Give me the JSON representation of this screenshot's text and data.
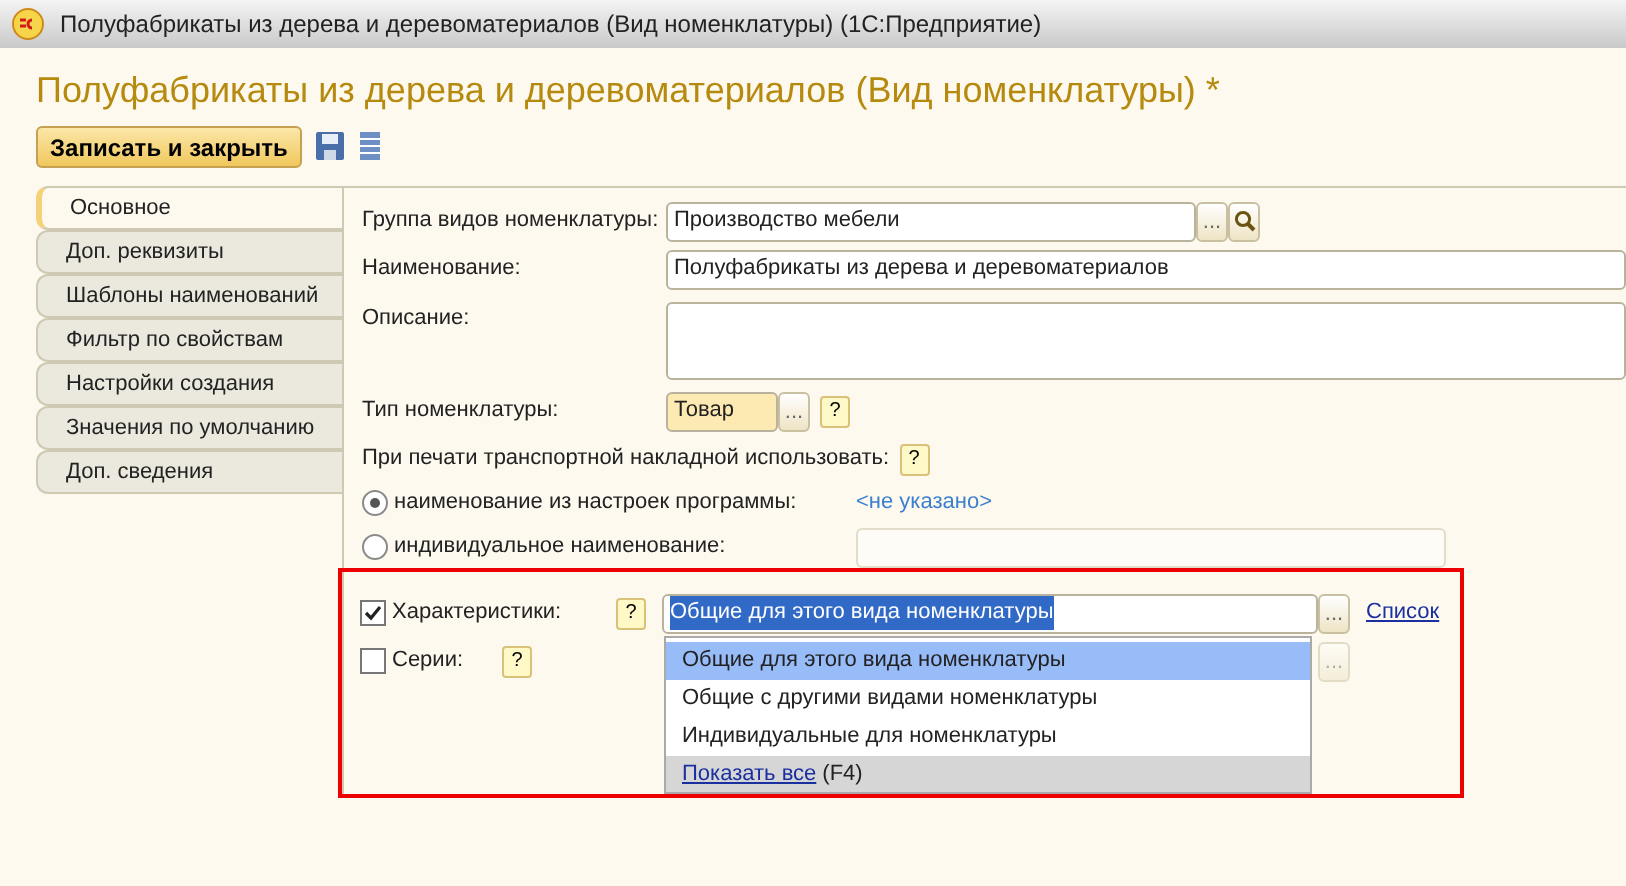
{
  "window": {
    "title": "Полуфабрикаты из дерева и деревоматериалов (Вид номенклатуры)  (1С:Предприятие)"
  },
  "form": {
    "title": "Полуфабрикаты из дерева и деревоматериалов (Вид номенклатуры) *"
  },
  "toolbar": {
    "primary_button": "Записать и закрыть"
  },
  "tabs": [
    {
      "label": "Основное",
      "selected": true
    },
    {
      "label": "Доп. реквизиты",
      "selected": false
    },
    {
      "label": "Шаблоны наименований",
      "selected": false
    },
    {
      "label": "Фильтр по свойствам",
      "selected": false
    },
    {
      "label": "Настройки создания",
      "selected": false
    },
    {
      "label": "Значения по умолчанию",
      "selected": false
    },
    {
      "label": "Доп. сведения",
      "selected": false
    }
  ],
  "fields": {
    "group": {
      "label": "Группа видов номенклатуры:",
      "value": "Производство мебели",
      "select_button": "..."
    },
    "name": {
      "label": "Наименование:",
      "value": "Полуфабрикаты из дерева и деревоматериалов"
    },
    "description": {
      "label": "Описание:"
    },
    "type": {
      "label": "Тип номенклатуры:",
      "value": "Товар",
      "select_button": "...",
      "help": "?"
    }
  },
  "print": {
    "label": "При печати транспортной накладной использовать:",
    "help": "?",
    "options": [
      {
        "label": "наименование из настроек программы:",
        "selected": true,
        "value": "<не указано>"
      },
      {
        "label": "индивидуальное наименование:",
        "selected": false
      }
    ]
  },
  "characteristics": {
    "label": "Характеристики:",
    "checked": true,
    "help": "?",
    "value": "Общие для этого вида номенклатуры",
    "link": "Список",
    "select_button": "..."
  },
  "series": {
    "label": "Серии:",
    "checked": false,
    "help": "?",
    "select_button": "...",
    "select_disabled": true
  },
  "dropdown": {
    "items": [
      {
        "label": "Общие для этого вида номенклатуры",
        "selected": true
      },
      {
        "label": "Общие с другими видами номенклатуры",
        "selected": false
      },
      {
        "label": "Индивидуальные для номенклатуры",
        "selected": false
      }
    ],
    "footer_link": "Показать все",
    "footer_hint": "(F4)"
  }
}
